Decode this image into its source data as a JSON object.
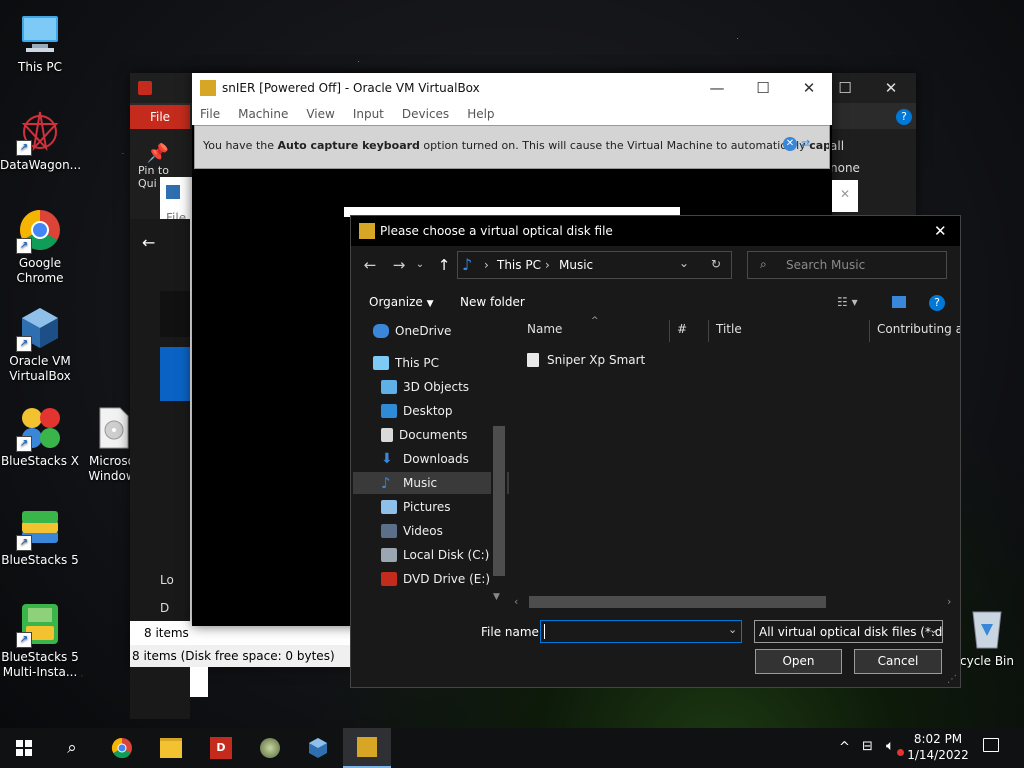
{
  "desktop": {
    "icons": [
      {
        "label": "This PC"
      },
      {
        "label": "DataWagon..."
      },
      {
        "label": "Google Chrome"
      },
      {
        "label": "Oracle VM VirtualBox"
      },
      {
        "label": "BlueStacks X"
      },
      {
        "label": "BlueStacks 5"
      },
      {
        "label": "BlueStacks 5 Multi-Insta..."
      },
      {
        "label": "Microso Window"
      },
      {
        "label": "cycle Bin"
      }
    ]
  },
  "explorer_back": {
    "file_tab": "File",
    "pin_label": "Pin to Qui a",
    "right_items": [
      "all",
      "none",
      "tion"
    ],
    "status_items": "8 items",
    "status_bar": "8 items (Disk free space: 0 bytes)",
    "sub_file": "File",
    "list_labels": [
      "Lo",
      "D"
    ]
  },
  "vbox": {
    "title": "snIER [Powered Off] - Oracle VM VirtualBox",
    "menu": [
      "File",
      "Machine",
      "View",
      "Input",
      "Devices",
      "Help"
    ],
    "notice_pre": "You have the ",
    "notice_bold1": "Auto capture keyboard",
    "notice_mid": " option turned on. This will cause the Virtual Machine to automatically ",
    "notice_bold2": "capture"
  },
  "dialog": {
    "title": "Please choose a virtual optical disk file",
    "breadcrumb": [
      "This PC",
      "Music"
    ],
    "search_placeholder": "Search Music",
    "organize": "Organize",
    "new_folder": "New folder",
    "nav_items": [
      {
        "label": "OneDrive",
        "icon": "cloud-icon"
      },
      {
        "label": "This PC",
        "icon": "computer-icon"
      },
      {
        "label": "3D Objects",
        "icon": "cube-icon"
      },
      {
        "label": "Desktop",
        "icon": "desktop-icon"
      },
      {
        "label": "Documents",
        "icon": "document-icon"
      },
      {
        "label": "Downloads",
        "icon": "download-icon"
      },
      {
        "label": "Music",
        "icon": "music-icon",
        "selected": true
      },
      {
        "label": "Pictures",
        "icon": "pictures-icon"
      },
      {
        "label": "Videos",
        "icon": "videos-icon"
      },
      {
        "label": "Local Disk (C:)",
        "icon": "disk-icon"
      },
      {
        "label": "DVD Drive (E:) P\\",
        "icon": "dvd-icon"
      }
    ],
    "columns": [
      "Name",
      "#",
      "Title",
      "Contributing art"
    ],
    "files": [
      {
        "name": "Sniper Xp Smart",
        "icon": "disc-file-icon"
      }
    ],
    "filename_label": "File name:",
    "filename_value": "",
    "filter_value": "All virtual optical disk files (*.dr",
    "open_label": "Open",
    "cancel_label": "Cancel"
  },
  "taskbar": {
    "time": "8:02 PM",
    "date": "1/14/2022",
    "apps": [
      "start-icon",
      "search-icon",
      "chrome-icon",
      "file-explorer-icon",
      "datawagon-icon",
      "app-icon",
      "virtualbox-icon",
      "vbox-vm-icon"
    ]
  },
  "colors": {
    "accent": "#0078d7",
    "red_tab": "#c42b1c",
    "dialog_bg": "#191919"
  }
}
